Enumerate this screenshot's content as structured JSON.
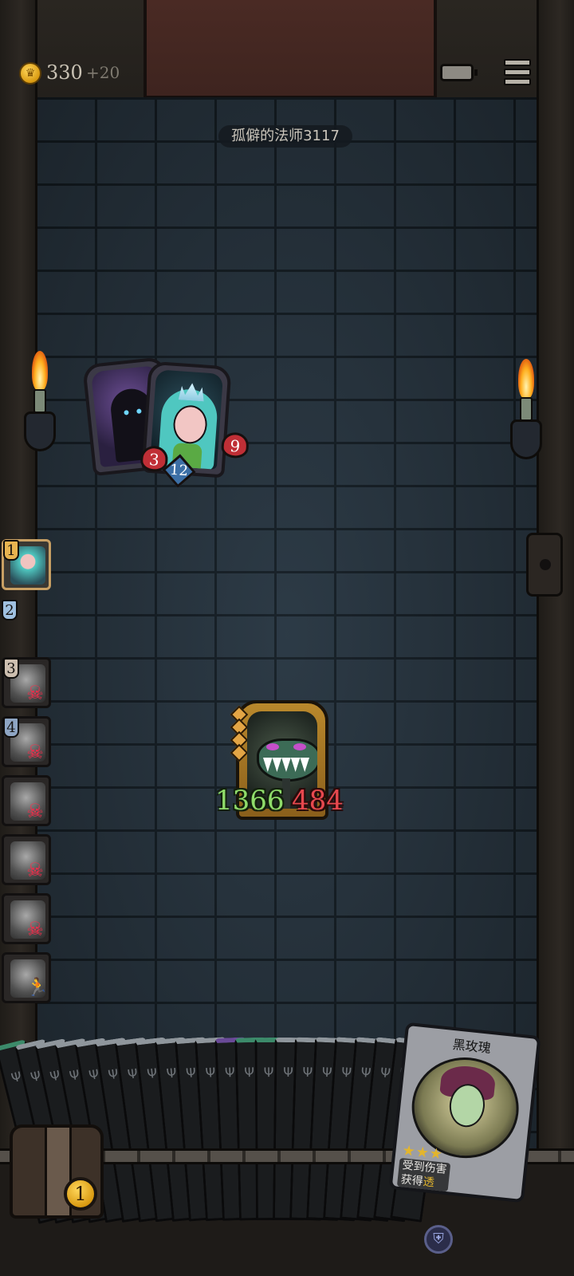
{
  "top_bar": {
    "coins": "330",
    "coin_gain": "+20"
  },
  "opponent": {
    "name": "孤僻的法师3117"
  },
  "enemy_units": [
    {
      "name": "shadow-hooded",
      "portrait": "hooded-shadow-figure"
    },
    {
      "name": "crystal-fairy",
      "portrait": "blue-haired-fairy",
      "attack": "3",
      "armor": "12",
      "health": "9"
    }
  ],
  "boss": {
    "portrait": "carnivorous-plant-monster",
    "health": "1366",
    "attack": "484"
  },
  "turn_queue": [
    {
      "order": "1",
      "portrait": "fairy-face",
      "status": "active"
    },
    {
      "order": "2",
      "portrait": "",
      "status": "pending"
    },
    {
      "order": "3",
      "portrait": "gargoyle",
      "status": "dead"
    },
    {
      "order": "4",
      "portrait": "masked-beast",
      "status": "dead"
    },
    {
      "order": "",
      "portrait": "wolf",
      "status": "dead"
    },
    {
      "order": "",
      "portrait": "bulldog",
      "status": "dead"
    },
    {
      "order": "",
      "portrait": "cat",
      "status": "dead"
    },
    {
      "order": "",
      "portrait": "rat",
      "status": "fled"
    }
  ],
  "featured_card": {
    "title": "黑玫瑰",
    "stars": "★★★",
    "text_line1": "受到伤害",
    "text_line2_prefix": "获得",
    "text_line2_highlight": "透"
  },
  "chest": {
    "count": "1"
  },
  "colors": {
    "health": "#8fdc6a",
    "attack": "#e7484e",
    "armor": "#3c6fa6",
    "gold": "#e3b52c"
  }
}
